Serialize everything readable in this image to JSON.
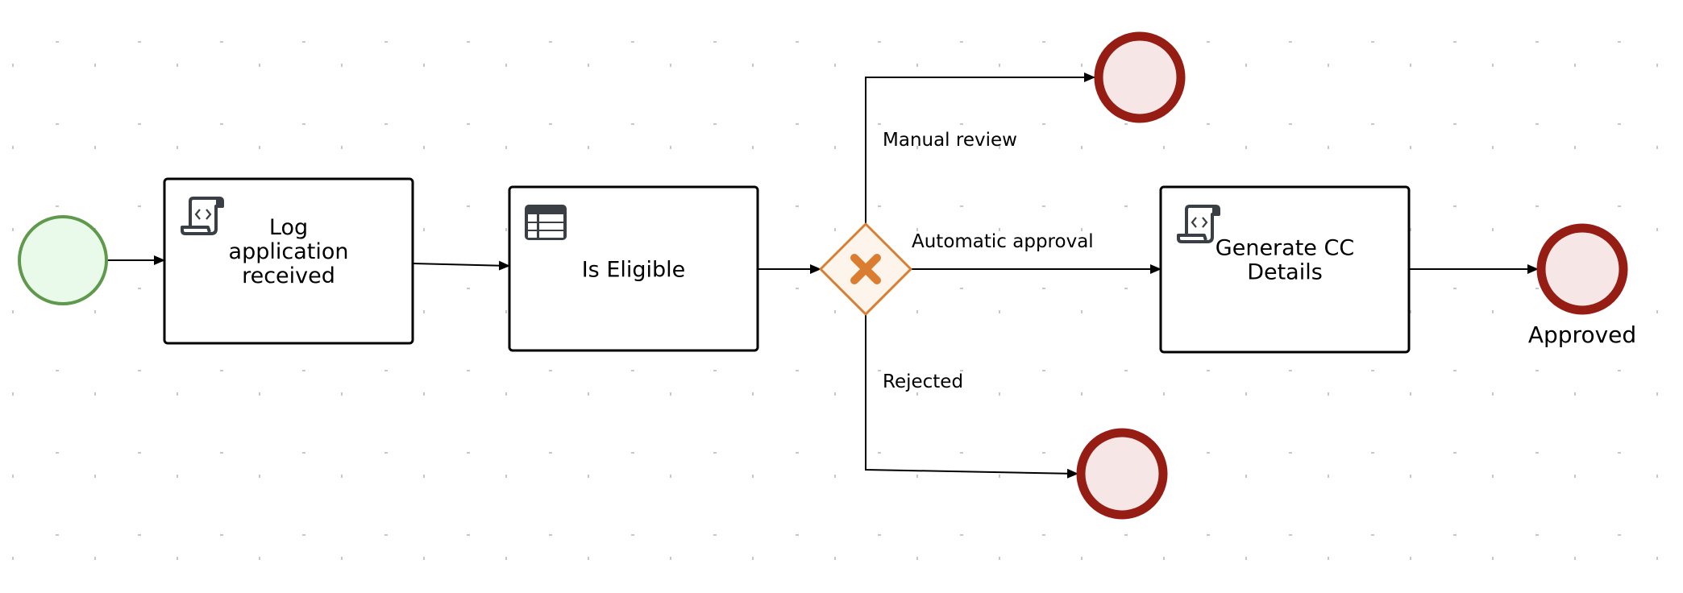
{
  "diagram": {
    "type": "BPMN process",
    "colors": {
      "start_stroke": "#5f9a4c",
      "start_fill": "#eafaea",
      "end_stroke": "#951d14",
      "end_fill": "#f7e6e6",
      "gateway_stroke": "#db7d30",
      "gateway_fill": "#fdf5eb",
      "task_stroke": "#000000",
      "task_fill": "#ffffff",
      "icon": "#393f44",
      "edge": "#000000",
      "grid": "#c8c8c8"
    },
    "nodes": [
      {
        "id": "start",
        "kind": "start-event",
        "label": ""
      },
      {
        "id": "log",
        "kind": "script-task",
        "icon": "script-icon",
        "label_lines": [
          "Log",
          "application",
          "received"
        ]
      },
      {
        "id": "eligible",
        "kind": "business-rule-task",
        "icon": "table-icon",
        "label_lines": [
          "Is Eligible"
        ]
      },
      {
        "id": "gateway",
        "kind": "exclusive-gateway",
        "icon": "x-icon",
        "label": ""
      },
      {
        "id": "end_manual",
        "kind": "end-event",
        "label": ""
      },
      {
        "id": "generate",
        "kind": "script-task",
        "icon": "script-icon",
        "label_lines": [
          "Generate CC",
          "Details"
        ]
      },
      {
        "id": "end_approved",
        "kind": "end-event",
        "label": "Approved"
      },
      {
        "id": "end_rejected",
        "kind": "end-event",
        "label": ""
      }
    ],
    "edges": [
      {
        "from": "start",
        "to": "log",
        "label": ""
      },
      {
        "from": "log",
        "to": "eligible",
        "label": ""
      },
      {
        "from": "eligible",
        "to": "gateway",
        "label": ""
      },
      {
        "from": "gateway",
        "to": "end_manual",
        "label": "Manual review"
      },
      {
        "from": "gateway",
        "to": "generate",
        "label": "Automatic approval"
      },
      {
        "from": "gateway",
        "to": "end_rejected",
        "label": "Rejected"
      },
      {
        "from": "generate",
        "to": "end_approved",
        "label": ""
      }
    ]
  }
}
